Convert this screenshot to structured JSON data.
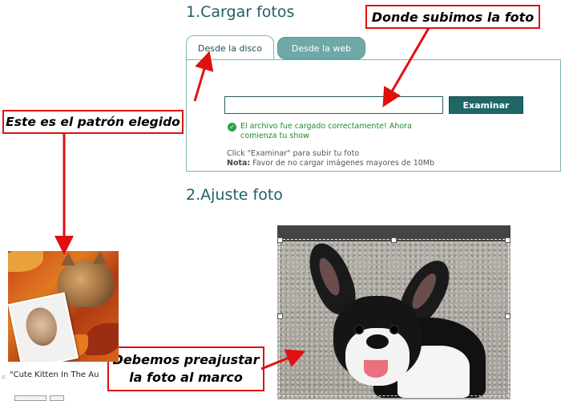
{
  "section1_title": "1.Cargar fotos",
  "section2_title": "2.Ajuste foto",
  "tabs": {
    "disk": "Desde la disco",
    "web": "Desde la web"
  },
  "upload": {
    "button_label": "Examinar",
    "input_value": "",
    "success_message": "El archivo fue cargado correctamente! Ahora comienza tu show",
    "help_text": "Click \"Examinar\" para subir tu foto",
    "note_label": "Nota:",
    "note_text": "Favor de no cargar imágenes mayores de 10Mb"
  },
  "callouts": {
    "upload_place": "Donde subimos la foto",
    "pattern_chosen": "Este es el patrón elegido",
    "preadjust_line1": "Debemos preajustar",
    "preadjust_line2": "la foto al marco"
  },
  "pattern": {
    "caption": "\"Cute Kitten In The Au"
  },
  "colors": {
    "accent": "#1f6666",
    "tab_inactive": "#6ea9a7",
    "success": "#1d8a2e",
    "callout_border": "#dd1111"
  }
}
